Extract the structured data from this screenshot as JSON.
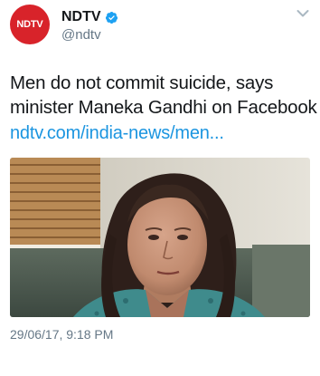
{
  "account": {
    "display_name": "NDTV",
    "handle": "@ndtv",
    "avatar_text": "NDTV",
    "verified_icon": "verified-badge-icon",
    "brand_color": "#d8232a",
    "verified_color": "#1da1f2"
  },
  "tweet": {
    "text": "Men do not commit suicide, says minister Maneka Gandhi on Facebook",
    "link": "ndtv.com/india-news/men...",
    "link_color": "#1b95e0",
    "timestamp": "29/06/17, 9:18 PM"
  },
  "menu": {
    "icon": "chevron-down-icon"
  }
}
